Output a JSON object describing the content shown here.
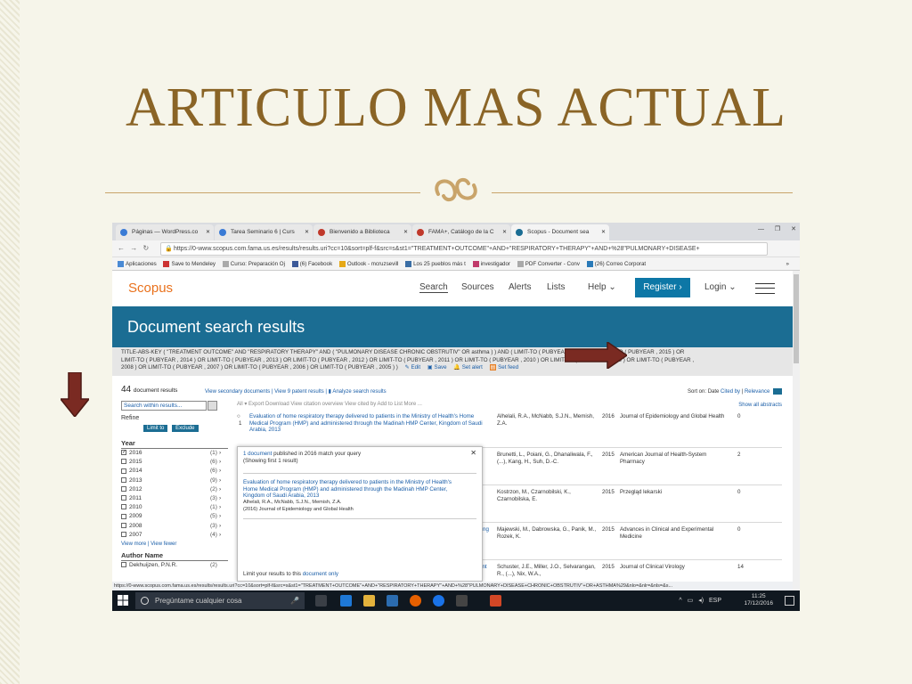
{
  "slide": {
    "title": "ARTICULO MAS ACTUAL",
    "ornament": "🙙",
    "colors": {
      "title": "#8a6426",
      "ornament": "#c9a46a",
      "arrow": "#7a2a22"
    }
  },
  "browser": {
    "tabs": [
      {
        "label": "Páginas — WordPress.co",
        "color": "#3a7bd5"
      },
      {
        "label": "Tarea Seminario 6 | Curs",
        "color": "#3a7bd5"
      },
      {
        "label": "Bienvenido a Biblioteca",
        "color": "#c0392b"
      },
      {
        "label": "FAMA+, Catálogo de la C",
        "color": "#c0392b"
      },
      {
        "label": "Scopus - Document sea",
        "color": "#1b6d93"
      }
    ],
    "url": "https://0-www.scopus.com.fama.us.es/results/results.uri?cc=10&sort=plf-f&src=s&st1=\"TREATMENT+OUTCOME\"+AND+\"RESPIRATORY+THERAPY\"+AND+%28\"PULMONARY+DISEASE+",
    "bookmarks": [
      "Aplicaciones",
      "Save to Mendeley",
      "Curso: Preparación Oj",
      "(6) Facebook",
      "Outlook - mcruzsevill",
      "Los 25 pueblos más t",
      "investigador",
      "PDF Converter - Conv",
      "(26) Correo Corporat"
    ],
    "bookmarks_more": "»",
    "status_url": "https://0-www.scopus.com.fama.us.es/results/results.uri?cc=10&sort=plf-f&src=s&st1=\"TREATMENT+OUTCOME\"+AND+\"RESPIRATORY+THERAPY\"+AND+%28\"PULMONARY+DISEASE+CHRONIC+OBSTRUTIV\"+OR+ASTHMA%29&nlo=&nlr=&nls=&s..."
  },
  "scopus": {
    "logo": "Scopus",
    "menu": {
      "search": "Search",
      "sources": "Sources",
      "alerts": "Alerts",
      "lists": "Lists",
      "help": "Help ⌄",
      "register": "Register ›",
      "login": "Login ⌄"
    },
    "banner": "Document search results",
    "query_lines": [
      "TITLE-ABS-KEY ( \"TREATMENT OUTCOME\" AND \"RESPIRATORY THERAPY\" AND ( \"PULMONARY DISEASE CHRONIC OBSTRUTIV\" OR asthma ) ) AND ( LIMIT-TO ( PUBYEAR , 2016 ) OR LIMIT-TO ( PUBYEAR , 2015 ) OR",
      "LIMIT-TO ( PUBYEAR , 2014 ) OR LIMIT-TO ( PUBYEAR , 2013 ) OR LIMIT-TO ( PUBYEAR , 2012 ) OR LIMIT-TO ( PUBYEAR , 2011 ) OR LIMIT-TO ( PUBYEAR , 2010 ) OR LIMIT-TO ( PUBYEAR , 2009 ) OR LIMIT-TO ( PUBYEAR ,",
      "2008 ) OR LIMIT-TO ( PUBYEAR , 2007 ) OR LIMIT-TO ( PUBYEAR , 2006 ) OR LIMIT-TO ( PUBYEAR , 2005 ) )"
    ],
    "query_actions": {
      "edit": "Edit",
      "save": "Save",
      "alert": "Set alert",
      "feed": "Set feed"
    },
    "count_number": "44",
    "count_label": "document results",
    "secondary": "View secondary documents",
    "patents": "View 9 patent results",
    "analyze": "Analyze search results",
    "sort": {
      "label": "Sort on:",
      "date": "Date",
      "cited": "Cited by",
      "relevance": "Relevance"
    },
    "tools": "All ▾   Export   Download   View citation overview   View cited by   Add to List   More ...",
    "show_abstracts": "Show all abstracts",
    "search_within": "Search within results...",
    "refine": "Refine",
    "limit_to": "Limit to",
    "exclude": "Exclude",
    "year_heading": "Year",
    "years": [
      {
        "y": "2016",
        "n": "(1)"
      },
      {
        "y": "2015",
        "n": "(6)"
      },
      {
        "y": "2014",
        "n": "(6)"
      },
      {
        "y": "2013",
        "n": "(9)"
      },
      {
        "y": "2012",
        "n": "(2)"
      },
      {
        "y": "2011",
        "n": "(3)"
      },
      {
        "y": "2010",
        "n": "(1)"
      },
      {
        "y": "2009",
        "n": "(5)"
      },
      {
        "y": "2008",
        "n": "(3)"
      },
      {
        "y": "2007",
        "n": "(4)"
      }
    ],
    "view_more": "View more",
    "view_fewer": "View fewer",
    "author_heading": "Author Name",
    "author_first": {
      "name": "Dekhuijzen, P.N.R.",
      "n": "(2)"
    },
    "results": [
      {
        "num": "1",
        "title": "Evaluation of home respiratory therapy delivered to patients in the Ministry of Health's Home Medical Program (HMP) and administered through the Madinah HMP Center, Kingdom of Saudi Arabia, 2013",
        "authors": "Alhelali, R.A., McNabb, S.J.N., Memish, Z.A.",
        "year": "2016",
        "source": "Journal of Epidemiology and Global Health",
        "cited": "0"
      },
      {
        "num": "",
        "title": "",
        "authors": "Brunetti, L., Poiani, G., Dhanaliwala, F., (...), Kang, H., Suh, D.-C.",
        "year": "2015",
        "source": "American Journal of Health-System Pharmacy",
        "cited": "2"
      },
      {
        "num": "",
        "title": "",
        "authors": "Kostrzon, M., Czarnobilski, K., Czarnobilska, E.",
        "year": "2015",
        "source": "Przegląd lekarski",
        "cited": "0"
      },
      {
        "num": "",
        "title": "ng",
        "authors": "Majewski, M., Dabrowska, G., Panik, M., Rozek, K.",
        "year": "2015",
        "source": "Advances in Clinical and Experimental Medicine",
        "cited": "0"
      },
      {
        "num": "",
        "title": "ent",
        "authors": "Schuster, J.E., Miller, J.O., Selvarangan, R., (...), Nix, W.A.,",
        "year": "2015",
        "source": "Journal of Clinical Virology",
        "cited": "14"
      }
    ],
    "popup": {
      "header_link": "1 document",
      "header_rest": " published in 2016 match your query",
      "subheader": "(Showing first 1 result)",
      "title": "Evaluation of home respiratory therapy delivered to patients in the Ministry of Health's Home Medical Program (HMP) and administered through the Madinah HMP Center, Kingdom of Saudi Arabia, 2013",
      "authors": "Alhelali, R.A., McNabb, S.J.N., Memish, Z.A.",
      "source": "(2016) Journal of Epidemiology and Global Health",
      "limit_text": "Limit your results to this ",
      "limit_link": "document only"
    }
  },
  "taskbar": {
    "cortana": "Pregúntame cualquier cosa",
    "lang": "ESP",
    "time": "11:25",
    "date": "17/12/2016"
  }
}
